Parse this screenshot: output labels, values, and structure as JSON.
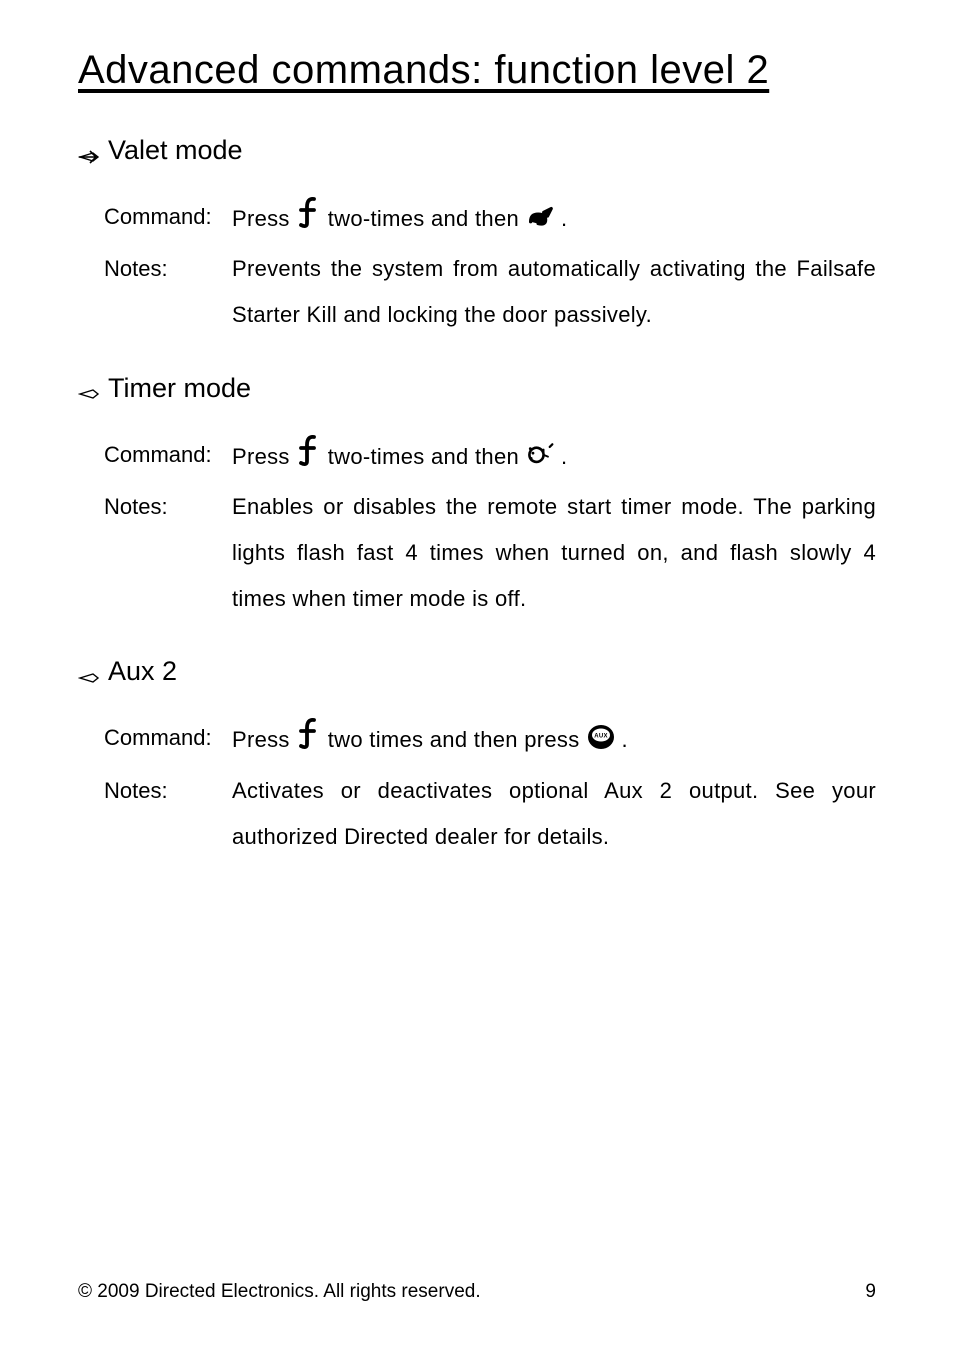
{
  "title": "Advanced commands: function level 2",
  "sections": [
    {
      "heading": "Valet mode",
      "command_label": "Command",
      "command_pre": "Press",
      "command_mid": "two-times and then",
      "command_end": ".",
      "notes_label": "Notes:",
      "notes": "Prevents the system from automatically activating the Failsafe Starter Kill and locking the door passively.",
      "second_icon": "s-icon"
    },
    {
      "heading": "Timer mode",
      "command_label": "Command",
      "command_pre": "Press",
      "command_mid": "two-times and then",
      "command_end": ".",
      "notes_label": "Notes",
      "notes": "Enables or disables the remote start timer mode. The parking lights flash fast 4 times when turned on, and flash slowly 4 times when timer mode is off.",
      "second_icon": "timer-icon"
    },
    {
      "heading": "Aux 2",
      "command_label": "Command",
      "command_pre": "Press",
      "command_mid": "two times and then press",
      "command_end": ".",
      "notes_label": "Notes",
      "notes": "Activates or deactivates optional Aux 2 output. See your authorized Directed dealer for details.",
      "second_icon": "aux-icon"
    }
  ],
  "footer": {
    "copyright": "© 2009 Directed Electronics. All rights reserved.",
    "page_number": "9"
  },
  "labels": {
    "colon": ":"
  }
}
